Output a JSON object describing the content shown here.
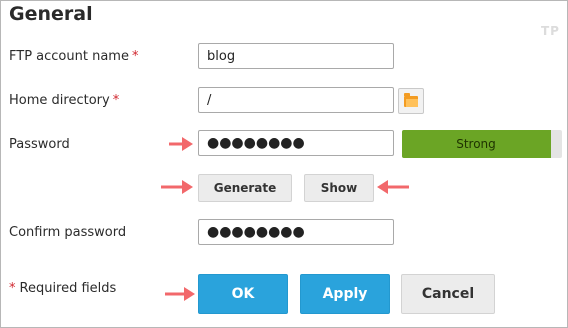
{
  "section": {
    "title": "General",
    "watermark": "TP"
  },
  "form": {
    "ftp_account": {
      "label": "FTP account name",
      "required_mark": "*",
      "value": "blog"
    },
    "home_directory": {
      "label": "Home directory",
      "required_mark": "*",
      "value": "/"
    },
    "password": {
      "label": "Password",
      "value": "●●●●●●●●"
    },
    "strength": {
      "label": "Strong",
      "level_percent": 93,
      "color": "#6ba525"
    },
    "generate_label": "Generate",
    "show_label": "Show",
    "confirm_password": {
      "label": "Confirm password",
      "value": "●●●●●●●●"
    },
    "required_note": {
      "mark": "*",
      "text": "Required fields"
    }
  },
  "actions": {
    "ok_label": "OK",
    "apply_label": "Apply",
    "cancel_label": "Cancel"
  },
  "colors": {
    "primary": "#2aa3dc",
    "required": "#d0262e",
    "arrow": "#f2686b"
  },
  "icons": {
    "folder": "folder-icon",
    "arrow": "arrow-icon"
  }
}
